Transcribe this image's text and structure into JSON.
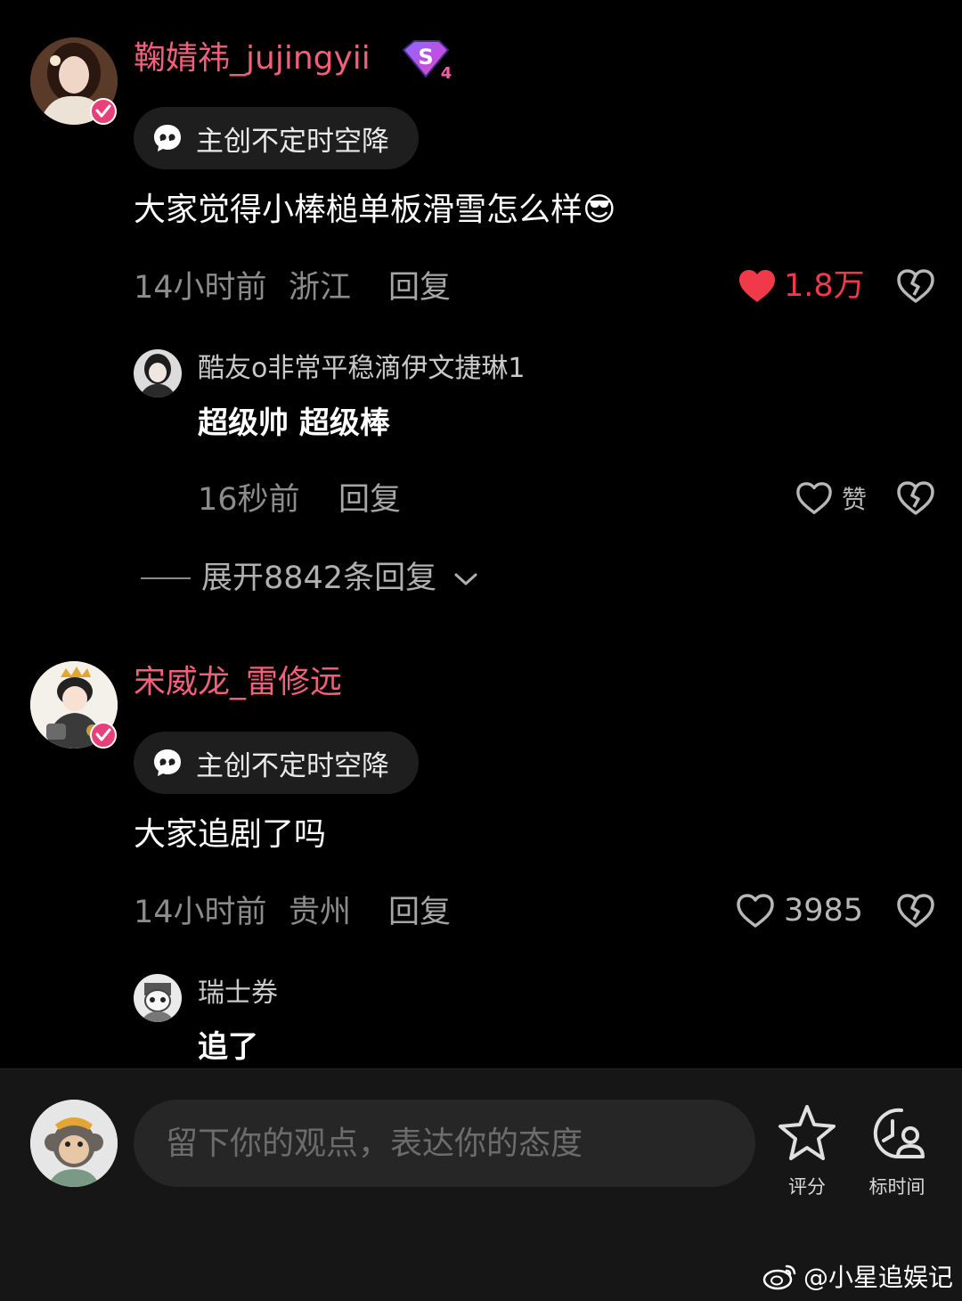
{
  "comments": [
    {
      "username": "鞠婧祎_jujingyii",
      "badge_text": "S",
      "badge_level": "4",
      "tag": "主创不定时空降",
      "text": "大家觉得小棒槌单板滑雪怎么样😎",
      "time": "14小时前",
      "location": "浙江",
      "reply_label": "回复",
      "likes": "1.8万",
      "liked": true,
      "replies": [
        {
          "username": "酷友o非常平稳滴伊文捷琳1",
          "text": "超级帅 超级棒",
          "time": "16秒前",
          "reply_label": "回复",
          "likes": "赞"
        }
      ],
      "expand_label": "展开8842条回复"
    },
    {
      "username": "宋威龙_雷修远",
      "tag": "主创不定时空降",
      "text": "大家追剧了吗",
      "time": "14小时前",
      "location": "贵州",
      "reply_label": "回复",
      "likes": "3985",
      "liked": false,
      "replies": [
        {
          "username": "瑞士券",
          "text": "追了"
        }
      ]
    }
  ],
  "bottom_bar": {
    "input_placeholder": "留下你的观点，表达你的态度",
    "rate_label": "评分",
    "timestamp_label": "标时间"
  },
  "watermark": "@小星追娱记",
  "colors": {
    "username_pink": "#f0607a",
    "like_red": "#f03a4a",
    "verified_badge": "#e8417a",
    "meta_gray": "#8c8c8c"
  }
}
